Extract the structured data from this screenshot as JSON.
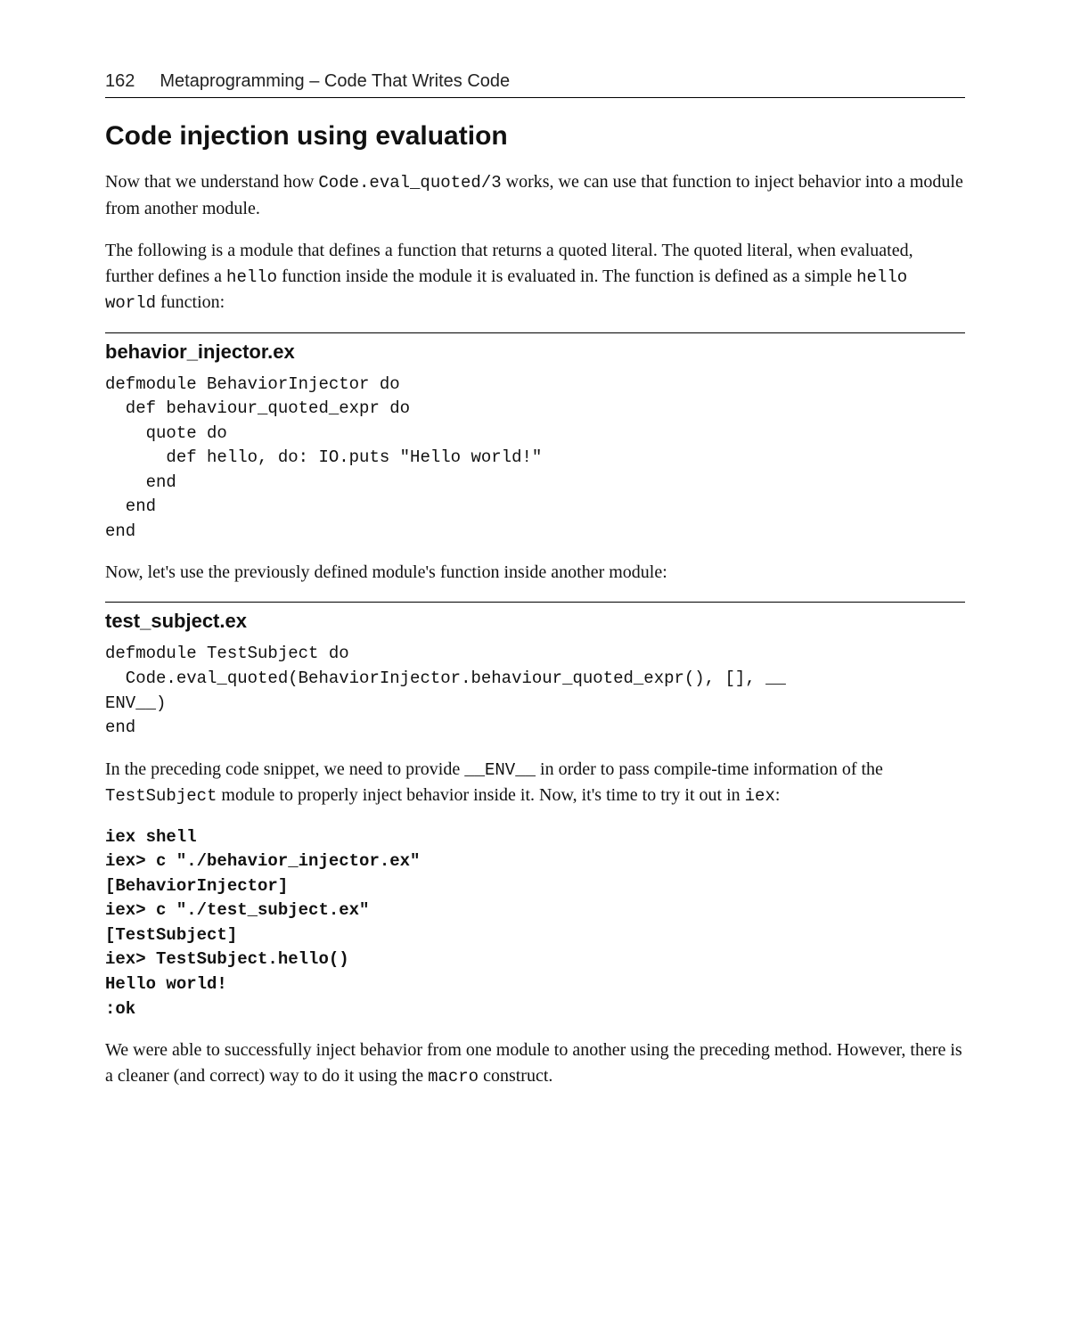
{
  "page_number": "162",
  "chapter_title": "Metaprogramming – Code That Writes Code",
  "section_title": "Code injection using evaluation",
  "p1_a": "Now that we understand how ",
  "p1_code1": "Code.eval_quoted/3",
  "p1_b": " works, we can use that function to inject behavior into a module from another module.",
  "p2_a": "The following is a module that defines a function that returns a quoted literal. The quoted literal, when evaluated, further defines a ",
  "p2_code1": "hello",
  "p2_b": " function inside the module it is evaluated in. The function is defined as a simple ",
  "p2_code2": "hello world",
  "p2_c": " function:",
  "file1_heading": "behavior_injector.ex",
  "code1": "defmodule BehaviorInjector do\n  def behaviour_quoted_expr do\n    quote do\n      def hello, do: IO.puts \"Hello world!\"\n    end\n  end\nend",
  "p3": "Now, let's use the previously defined module's function inside another module:",
  "file2_heading": "test_subject.ex",
  "code2": "defmodule TestSubject do\n  Code.eval_quoted(BehaviorInjector.behaviour_quoted_expr(), [], __\nENV__)\nend",
  "p4_a": "In the preceding code snippet, we need to provide ",
  "p4_code1": "__ENV__",
  "p4_b": " in order to pass compile-time information of the ",
  "p4_code2": "TestSubject",
  "p4_c": " module to properly inject behavior inside it. Now, it's time to try it out in ",
  "p4_code3": "iex",
  "p4_d": ":",
  "code3": "iex shell\niex> c \"./behavior_injector.ex\"\n[BehaviorInjector]\niex> c \"./test_subject.ex\"\n[TestSubject]\niex> TestSubject.hello()\nHello world!\n:ok",
  "p5_a": "We were able to successfully inject behavior from one module to another using the preceding method. However, there is a cleaner (and correct) way to do it using the ",
  "p5_code1": "macro",
  "p5_b": " construct."
}
